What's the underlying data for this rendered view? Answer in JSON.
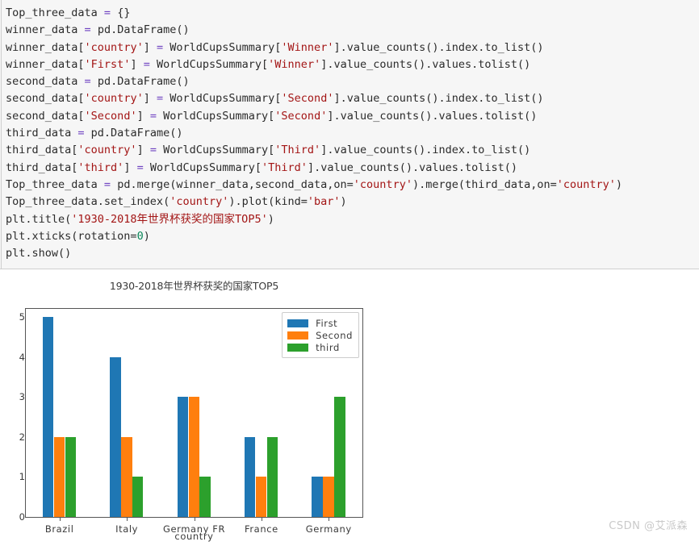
{
  "code": {
    "language": "python",
    "background": "#f6f6f6",
    "lines": [
      [
        {
          "t": "Top_three_data ",
          "c": "plain"
        },
        {
          "t": "=",
          "c": "op"
        },
        {
          "t": " {}",
          "c": "plain"
        }
      ],
      [
        {
          "t": "winner_data ",
          "c": "plain"
        },
        {
          "t": "=",
          "c": "op"
        },
        {
          "t": " pd.DataFrame()",
          "c": "plain"
        }
      ],
      [
        {
          "t": "winner_data[",
          "c": "plain"
        },
        {
          "t": "'country'",
          "c": "str"
        },
        {
          "t": "] ",
          "c": "plain"
        },
        {
          "t": "=",
          "c": "op"
        },
        {
          "t": " WorldCupsSummary[",
          "c": "plain"
        },
        {
          "t": "'Winner'",
          "c": "str"
        },
        {
          "t": "].value_counts().index.to_list()",
          "c": "plain"
        }
      ],
      [
        {
          "t": "winner_data[",
          "c": "plain"
        },
        {
          "t": "'First'",
          "c": "str"
        },
        {
          "t": "] ",
          "c": "plain"
        },
        {
          "t": "=",
          "c": "op"
        },
        {
          "t": " WorldCupsSummary[",
          "c": "plain"
        },
        {
          "t": "'Winner'",
          "c": "str"
        },
        {
          "t": "].value_counts().values.tolist()",
          "c": "plain"
        }
      ],
      [
        {
          "t": "second_data ",
          "c": "plain"
        },
        {
          "t": "=",
          "c": "op"
        },
        {
          "t": " pd.DataFrame()",
          "c": "plain"
        }
      ],
      [
        {
          "t": "second_data[",
          "c": "plain"
        },
        {
          "t": "'country'",
          "c": "str"
        },
        {
          "t": "] ",
          "c": "plain"
        },
        {
          "t": "=",
          "c": "op"
        },
        {
          "t": " WorldCupsSummary[",
          "c": "plain"
        },
        {
          "t": "'Second'",
          "c": "str"
        },
        {
          "t": "].value_counts().index.to_list()",
          "c": "plain"
        }
      ],
      [
        {
          "t": "second_data[",
          "c": "plain"
        },
        {
          "t": "'Second'",
          "c": "str"
        },
        {
          "t": "] ",
          "c": "plain"
        },
        {
          "t": "=",
          "c": "op"
        },
        {
          "t": " WorldCupsSummary[",
          "c": "plain"
        },
        {
          "t": "'Second'",
          "c": "str"
        },
        {
          "t": "].value_counts().values.tolist()",
          "c": "plain"
        }
      ],
      [
        {
          "t": "third_data ",
          "c": "plain"
        },
        {
          "t": "=",
          "c": "op"
        },
        {
          "t": " pd.DataFrame()",
          "c": "plain"
        }
      ],
      [
        {
          "t": "third_data[",
          "c": "plain"
        },
        {
          "t": "'country'",
          "c": "str"
        },
        {
          "t": "] ",
          "c": "plain"
        },
        {
          "t": "=",
          "c": "op"
        },
        {
          "t": " WorldCupsSummary[",
          "c": "plain"
        },
        {
          "t": "'Third'",
          "c": "str"
        },
        {
          "t": "].value_counts().index.to_list()",
          "c": "plain"
        }
      ],
      [
        {
          "t": "third_data[",
          "c": "plain"
        },
        {
          "t": "'third'",
          "c": "str"
        },
        {
          "t": "] ",
          "c": "plain"
        },
        {
          "t": "=",
          "c": "op"
        },
        {
          "t": " WorldCupsSummary[",
          "c": "plain"
        },
        {
          "t": "'Third'",
          "c": "str"
        },
        {
          "t": "].value_counts().values.tolist()",
          "c": "plain"
        }
      ],
      [
        {
          "t": "Top_three_data ",
          "c": "plain"
        },
        {
          "t": "=",
          "c": "op"
        },
        {
          "t": " pd.merge(winner_data,second_data,on=",
          "c": "plain"
        },
        {
          "t": "'country'",
          "c": "str"
        },
        {
          "t": ").merge(third_data,on=",
          "c": "plain"
        },
        {
          "t": "'country'",
          "c": "str"
        },
        {
          "t": ")",
          "c": "plain"
        }
      ],
      [
        {
          "t": "Top_three_data.set_index(",
          "c": "plain"
        },
        {
          "t": "'country'",
          "c": "str"
        },
        {
          "t": ").plot(kind=",
          "c": "plain"
        },
        {
          "t": "'bar'",
          "c": "str"
        },
        {
          "t": ")",
          "c": "plain"
        }
      ],
      [
        {
          "t": "plt.title(",
          "c": "plain"
        },
        {
          "t": "'1930-2018年世界杯获奖的国家TOP5'",
          "c": "str"
        },
        {
          "t": ")",
          "c": "plain"
        }
      ],
      [
        {
          "t": "plt.xticks(rotation=",
          "c": "plain"
        },
        {
          "t": "0",
          "c": "num"
        },
        {
          "t": ")",
          "c": "plain"
        }
      ],
      [
        {
          "t": "plt.show()",
          "c": "plain"
        }
      ]
    ]
  },
  "chart_data": {
    "type": "bar",
    "title": "1930-2018年世界杯获奖的国家TOP5",
    "xlabel": "country",
    "ylabel": "",
    "categories": [
      "Brazil",
      "Italy",
      "Germany FR",
      "France",
      "Germany"
    ],
    "series": [
      {
        "name": "First",
        "color": "#1f77b4",
        "values": [
          5,
          4,
          3,
          2,
          1
        ]
      },
      {
        "name": "Second",
        "color": "#ff7f0e",
        "values": [
          2,
          2,
          3,
          1,
          1
        ]
      },
      {
        "name": "third",
        "color": "#2ca02c",
        "values": [
          2,
          1,
          1,
          2,
          3
        ]
      }
    ],
    "ylim": [
      0,
      5.2
    ],
    "yticks": [
      0,
      1,
      2,
      3,
      4,
      5
    ],
    "grid": false,
    "legend_position": "upper right",
    "frame": true
  },
  "watermark": {
    "text": "CSDN @艾派森"
  }
}
